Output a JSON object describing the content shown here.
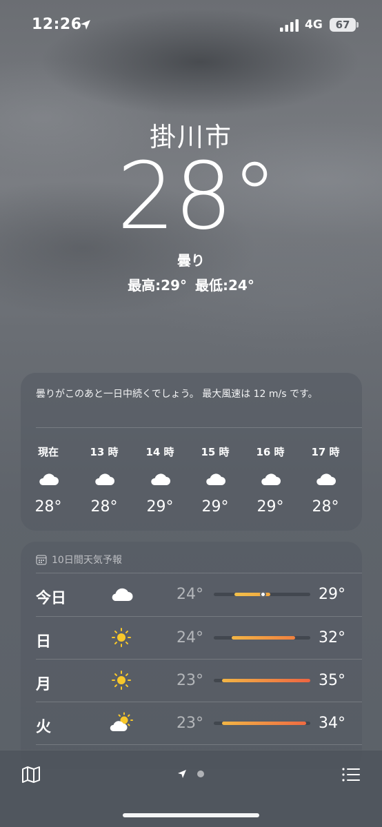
{
  "status_bar": {
    "time": "12:26",
    "network": "4G",
    "battery": "67"
  },
  "header": {
    "city": "掛川市",
    "temperature": "28°",
    "condition": "曇り",
    "high": "最高:29°",
    "low": "最低:24°"
  },
  "hourly": {
    "summary": "曇りがこのあと一日中続くでしょう。 最大風速は 12 m/s です。",
    "hours": [
      {
        "label": "現在",
        "icon": "cloud-icon",
        "temp": "28°"
      },
      {
        "label": "13 時",
        "icon": "cloud-icon",
        "temp": "28°"
      },
      {
        "label": "14 時",
        "icon": "cloud-icon",
        "temp": "29°"
      },
      {
        "label": "15 時",
        "icon": "cloud-icon",
        "temp": "29°"
      },
      {
        "label": "16 時",
        "icon": "cloud-icon",
        "temp": "29°"
      },
      {
        "label": "17 時",
        "icon": "cloud-icon",
        "temp": "28°"
      }
    ]
  },
  "forecast": {
    "title": "10日間天気予報",
    "days": [
      {
        "day": "今日",
        "icon": "cloud-icon",
        "low": "24°",
        "high": "29°",
        "current": true
      },
      {
        "day": "日",
        "icon": "sun-icon",
        "low": "24°",
        "high": "32°"
      },
      {
        "day": "月",
        "icon": "sun-icon",
        "low": "23°",
        "high": "35°"
      },
      {
        "day": "火",
        "icon": "partly-cloudy-icon",
        "low": "23°",
        "high": "34°"
      }
    ]
  },
  "bottom_bar": {
    "icons": [
      "map-icon",
      "location-arrow-icon",
      "page-dot",
      "list-icon"
    ]
  },
  "colors": {
    "bar_start": "#f2b545",
    "bar_end": "#ef6b42",
    "sun": "#f7c72b"
  }
}
